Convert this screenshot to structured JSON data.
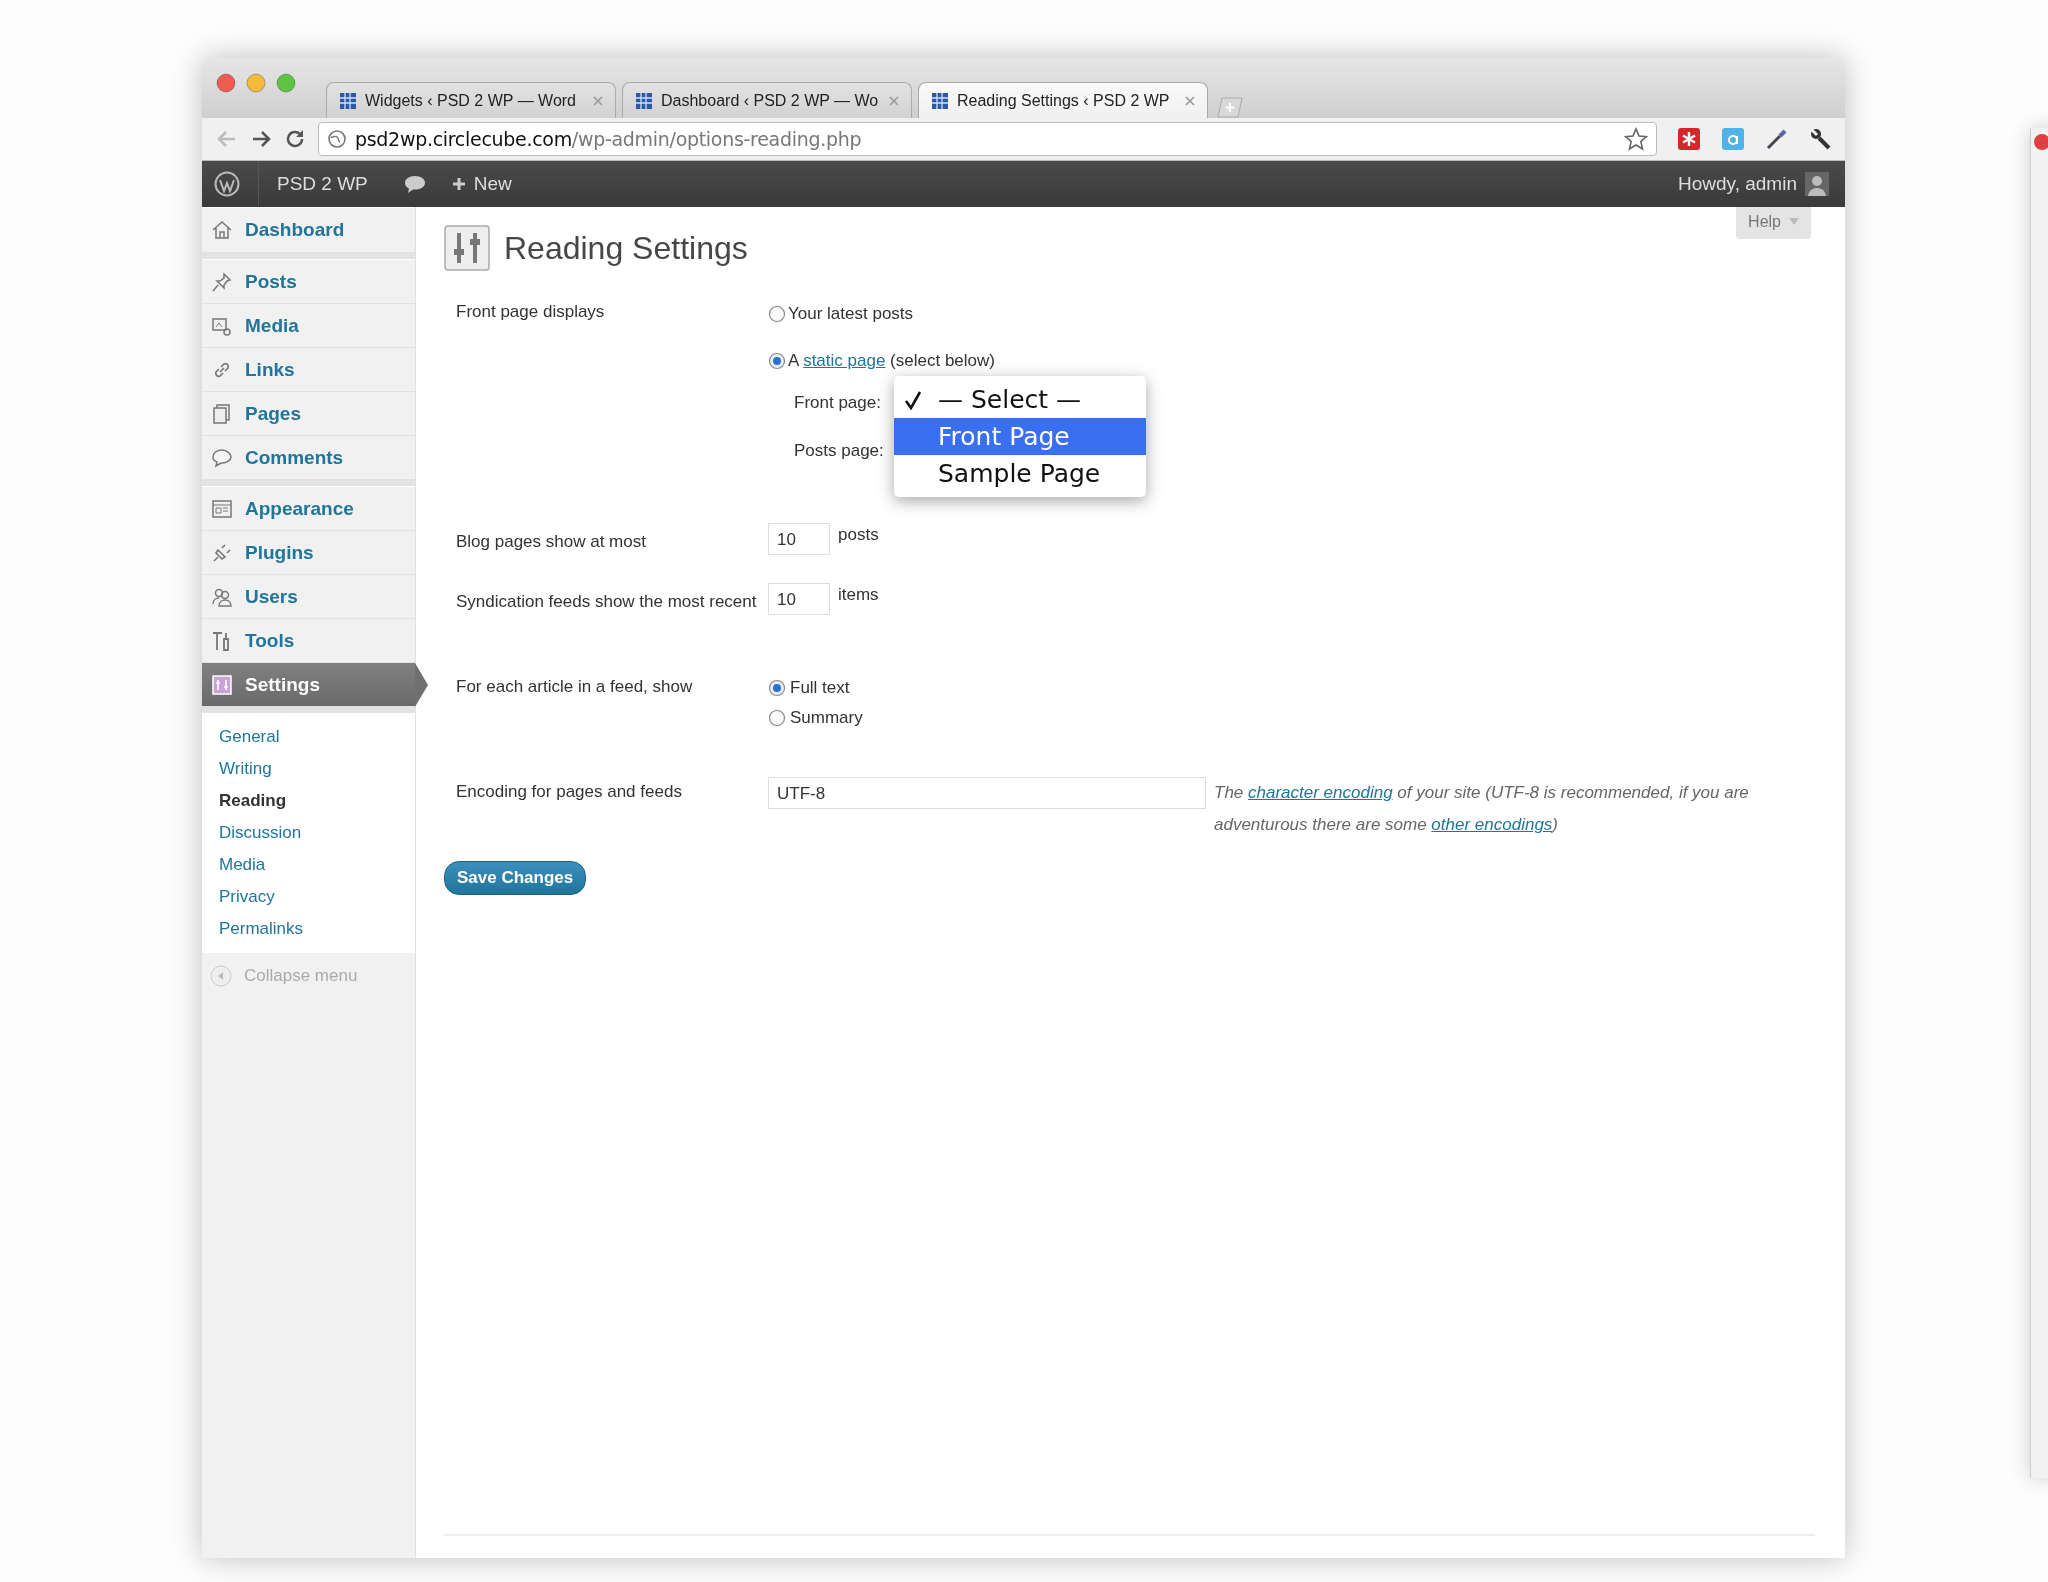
{
  "browser": {
    "tabs": [
      {
        "title": "Widgets ‹ PSD 2 WP — Word",
        "selected": false
      },
      {
        "title": "Dashboard ‹ PSD 2 WP — Wo",
        "selected": false
      },
      {
        "title": "Reading Settings ‹ PSD 2 WP",
        "selected": true
      }
    ],
    "address": {
      "host": "psd2wp.circlecube.com",
      "path": "/wp-admin/options-reading.php"
    }
  },
  "admin_bar": {
    "site": "PSD 2 WP",
    "new": "New",
    "greeting": "Howdy, admin"
  },
  "sidebar": {
    "groups": [
      [
        {
          "label": "Dashboard",
          "selected": false
        }
      ],
      [
        {
          "label": "Posts",
          "selected": false
        },
        {
          "label": "Media",
          "selected": false
        },
        {
          "label": "Links",
          "selected": false
        },
        {
          "label": "Pages",
          "selected": false
        },
        {
          "label": "Comments",
          "selected": false
        }
      ],
      [
        {
          "label": "Appearance",
          "selected": false
        },
        {
          "label": "Plugins",
          "selected": false
        },
        {
          "label": "Users",
          "selected": false
        },
        {
          "label": "Tools",
          "selected": false
        },
        {
          "label": "Settings",
          "selected": true
        }
      ]
    ],
    "submenu": [
      {
        "label": "General",
        "selected": false
      },
      {
        "label": "Writing",
        "selected": false
      },
      {
        "label": "Reading",
        "selected": true
      },
      {
        "label": "Discussion",
        "selected": false
      },
      {
        "label": "Media",
        "selected": false
      },
      {
        "label": "Privacy",
        "selected": false
      },
      {
        "label": "Permalinks",
        "selected": false
      }
    ],
    "collapse": "Collapse menu"
  },
  "page": {
    "help": "Help",
    "title": "Reading Settings",
    "front_page_displays": {
      "label": "Front page displays",
      "options": [
        {
          "before": "Your latest posts",
          "selected": false
        },
        {
          "before": "A",
          "link": "static page",
          "after": "(select below)",
          "selected": true
        }
      ]
    },
    "front_page": {
      "label": "Front page:",
      "menu": [
        {
          "label": "— Select —",
          "checked": true,
          "highlighted": false
        },
        {
          "label": "Front Page",
          "checked": false,
          "highlighted": true
        },
        {
          "label": "Sample Page",
          "checked": false,
          "highlighted": false
        }
      ]
    },
    "posts_page": {
      "label": "Posts page:"
    },
    "blog_pages": {
      "label": "Blog pages show at most",
      "value": "10",
      "unit": "posts"
    },
    "syndication": {
      "label": "Syndication feeds show the most recent",
      "value": "10",
      "unit": "items"
    },
    "feed_article": {
      "label": "For each article in a feed, show",
      "options": [
        {
          "label": "Full text",
          "selected": true
        },
        {
          "label": "Summary",
          "selected": false
        }
      ]
    },
    "encoding": {
      "label": "Encoding for pages and feeds",
      "value": "UTF-8",
      "text_1": "The",
      "link_1": "character encoding",
      "text_2": "of your site (UTF-8 is recommended, if you are adventurous there are some",
      "link_2": "other encodings",
      "text_3": ")"
    },
    "save": "Save Changes"
  }
}
